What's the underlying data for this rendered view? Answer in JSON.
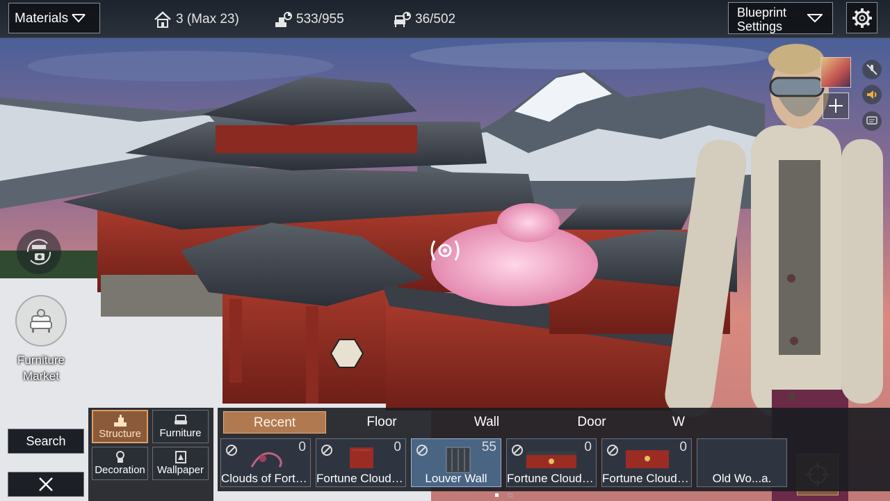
{
  "topbar": {
    "materials_label": "Materials",
    "population": "3 (Max 23)",
    "structure_count": "533/955",
    "furniture_count": "36/502",
    "blueprint_label": "Blueprint Settings"
  },
  "left": {
    "furniture_market_label": "Furniture Market"
  },
  "bottom": {
    "search_label": "Search",
    "categories": [
      {
        "label": "Structure",
        "icon": "structure-icon",
        "active": true
      },
      {
        "label": "Furniture",
        "icon": "armchair-icon",
        "active": false
      },
      {
        "label": "Decoration",
        "icon": "decoration-icon",
        "active": false
      },
      {
        "label": "Wallpaper",
        "icon": "wallpaper-icon",
        "active": false
      }
    ],
    "tabs": [
      {
        "label": "Recent",
        "active": true
      },
      {
        "label": "Floor",
        "active": false
      },
      {
        "label": "Wall",
        "active": false
      },
      {
        "label": "Door",
        "active": false
      },
      {
        "label": "W",
        "active": false
      }
    ],
    "items": [
      {
        "name": "Clouds of Fortu...",
        "count": "0",
        "selected": false
      },
      {
        "name": "Fortune Clouds ...",
        "count": "0",
        "selected": false
      },
      {
        "name": "Louver Wall",
        "count": "55",
        "selected": true
      },
      {
        "name": "Fortune Clouds ...",
        "count": "0",
        "selected": false
      },
      {
        "name": "Fortune Clouds ...",
        "count": "0",
        "selected": false
      },
      {
        "name": "Old Wo...a.",
        "count": "",
        "selected": false
      }
    ]
  },
  "colors": {
    "accent_active": "#b07950",
    "selected_item": "#4a6484",
    "panel_bg": "#191c21"
  }
}
